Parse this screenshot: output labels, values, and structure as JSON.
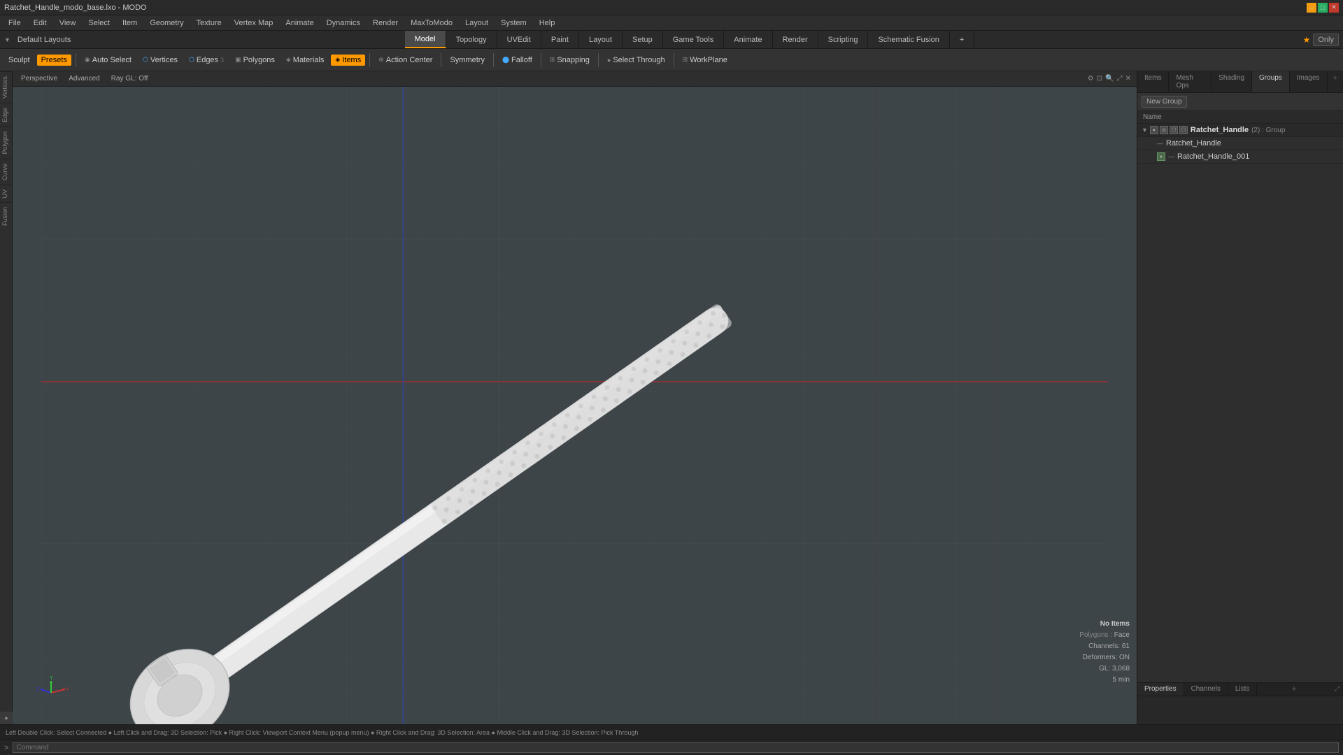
{
  "titlebar": {
    "title": "Ratchet_Handle_modo_base.lxo - MODO",
    "min": "–",
    "max": "□",
    "close": "✕"
  },
  "menubar": {
    "items": [
      "File",
      "Edit",
      "View",
      "Select",
      "Item",
      "Geometry",
      "Texture",
      "Vertex Map",
      "Animate",
      "Dynamics",
      "Render",
      "MaxToModo",
      "Layout",
      "System",
      "Help"
    ]
  },
  "toptabs": {
    "layout_label": "Default Layouts",
    "tabs": [
      "Model",
      "Topology",
      "UVEdit",
      "Paint",
      "Layout",
      "Setup",
      "Game Tools",
      "Animate",
      "Render",
      "Scripting",
      "Schematic Fusion"
    ],
    "active_tab": "Model",
    "add_tab": "+",
    "star": "★",
    "only": "Only"
  },
  "sculpt_toolbar": {
    "sculpt": "Sculpt",
    "presets": "Presets",
    "auto_select": "Auto Select",
    "vertices": "Vertices",
    "edges": "Edges",
    "polygons": "Polygons",
    "materials": "Materials",
    "items": "Items",
    "action_center": "Action Center",
    "symmetry": "Symmetry",
    "falloff": "Falloff",
    "snapping": "Snapping",
    "select_through": "Select Through",
    "workplane": "WorkPlane"
  },
  "viewport": {
    "perspective": "Perspective",
    "advanced": "Advanced",
    "ray_gl": "Ray GL: Off"
  },
  "right_panel": {
    "tabs": [
      "Items",
      "Mesh Ops",
      "Shading",
      "Groups",
      "Images"
    ],
    "active_tab": "Groups",
    "add": "+",
    "new_group": "New Group",
    "name_header": "Name",
    "tree": [
      {
        "id": "group1",
        "label": "Ratchet_Handle",
        "type": "(2) : Group",
        "level": 0,
        "expanded": true,
        "selected": false,
        "is_group": true
      },
      {
        "id": "item1",
        "label": "Ratchet_Handle",
        "type": "",
        "level": 1,
        "expanded": false,
        "selected": false,
        "is_group": false
      },
      {
        "id": "item2",
        "label": "Ratchet_Handle_001",
        "type": "",
        "level": 1,
        "expanded": false,
        "selected": false,
        "is_group": false
      }
    ]
  },
  "bottom_panel": {
    "tabs": [
      "Properties",
      "Channels",
      "Lists"
    ],
    "active_tab": "Properties",
    "add": "+"
  },
  "stats": {
    "no_items": "No Items",
    "polygons_label": "Polygons :",
    "polygons_value": "Face",
    "channels_label": "Channels: 61",
    "deformers_label": "Deformers: ON",
    "gl_label": "GL: 3,068",
    "time": "5 min"
  },
  "statusbar": {
    "text": "Left Double Click: Select Connected ●  Left Click and Drag: 3D Selection: Pick ●  Right Click: Viewport Context Menu (popup menu) ●  Right Click and Drag: 3D Selection: Area ●  Middle Click and Drag: 3D Selection: Pick Through"
  },
  "commandbar": {
    "arrow": ">",
    "placeholder": "Command",
    "label": "Command"
  }
}
